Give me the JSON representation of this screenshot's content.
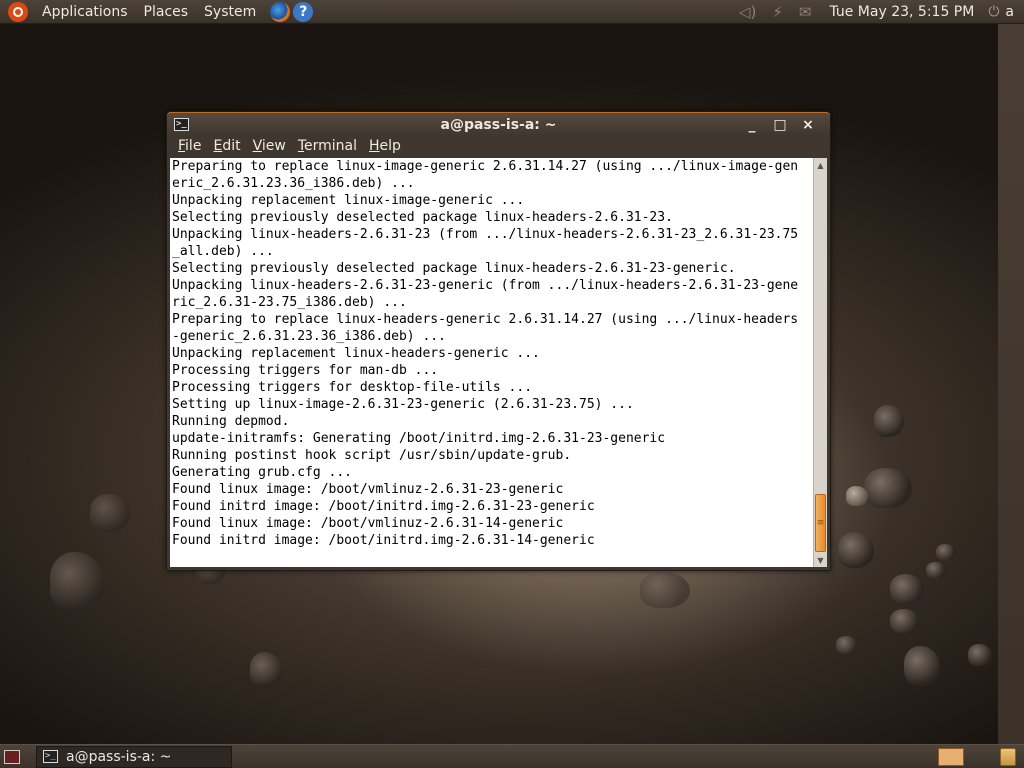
{
  "top_panel": {
    "applications": "Applications",
    "places": "Places",
    "system": "System",
    "clock": "Tue May 23,  5:15 PM",
    "user": "a",
    "icons": [
      "ubuntu-logo",
      "firefox-icon",
      "help-icon",
      "volume-icon",
      "network-icon",
      "mail-icon",
      "power-icon"
    ]
  },
  "window": {
    "title": "a@pass-is-a: ~",
    "buttons": {
      "minimize": "_",
      "maximize": "□",
      "close": "×"
    },
    "menu": [
      "File",
      "Edit",
      "View",
      "Terminal",
      "Help"
    ],
    "terminal_lines": [
      "Preparing to replace linux-image-generic 2.6.31.14.27 (using .../linux-image-gen",
      "eric_2.6.31.23.36_i386.deb) ...",
      "Unpacking replacement linux-image-generic ...",
      "Selecting previously deselected package linux-headers-2.6.31-23.",
      "Unpacking linux-headers-2.6.31-23 (from .../linux-headers-2.6.31-23_2.6.31-23.75",
      "_all.deb) ...",
      "Selecting previously deselected package linux-headers-2.6.31-23-generic.",
      "Unpacking linux-headers-2.6.31-23-generic (from .../linux-headers-2.6.31-23-gene",
      "ric_2.6.31-23.75_i386.deb) ...",
      "Preparing to replace linux-headers-generic 2.6.31.14.27 (using .../linux-headers",
      "-generic_2.6.31.23.36_i386.deb) ...",
      "Unpacking replacement linux-headers-generic ...",
      "Processing triggers for man-db ...",
      "Processing triggers for desktop-file-utils ...",
      "Setting up linux-image-2.6.31-23-generic (2.6.31-23.75) ...",
      "Running depmod.",
      "update-initramfs: Generating /boot/initrd.img-2.6.31-23-generic",
      "Running postinst hook script /usr/sbin/update-grub.",
      "Generating grub.cfg ...",
      "Found linux image: /boot/vmlinuz-2.6.31-23-generic",
      "Found initrd image: /boot/initrd.img-2.6.31-23-generic",
      "Found linux image: /boot/vmlinuz-2.6.31-14-generic",
      "Found initrd image: /boot/initrd.img-2.6.31-14-generic"
    ],
    "scroll_position_fraction": 0.93
  },
  "bottom_panel": {
    "taskbar_title": "a@pass-is-a: ~",
    "icons": [
      "show-desktop-icon",
      "terminal-icon",
      "workspace-switcher",
      "trash-icon"
    ]
  }
}
